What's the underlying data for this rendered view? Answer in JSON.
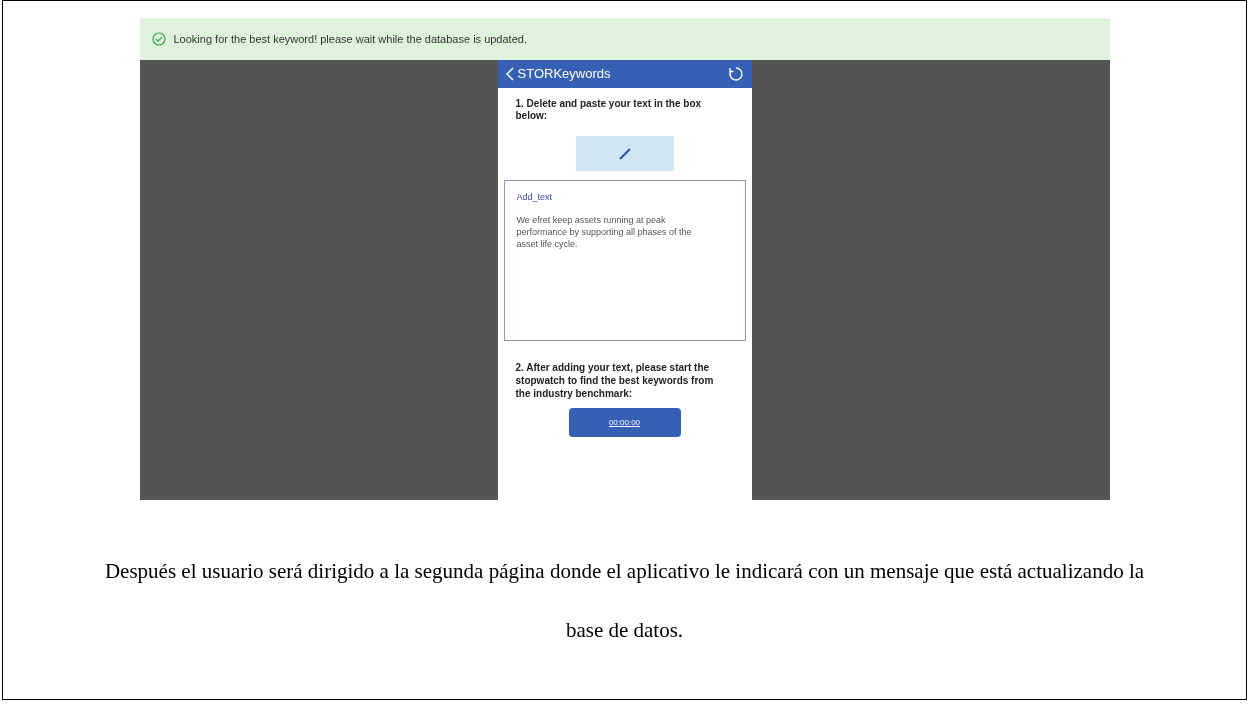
{
  "notification": {
    "message": "Looking for the best keyword! please wait while the database is updated."
  },
  "app": {
    "title": "STORKeywords",
    "step_1": "1. Delete and paste your text in the box below:",
    "text_box": {
      "label": "Add_text",
      "value": "We efret keep assets running at peak performance by supporting all phases of the asset life cycle."
    },
    "step_2": "2. After adding your text, please start the stopwatch to find the best keywords from the industry benchmark:",
    "timer_button": "00:00:00"
  },
  "caption": "Después el usuario será dirigido a la segunda página donde el aplicativo le indicará con un mensaje que está actualizando la base de datos."
}
